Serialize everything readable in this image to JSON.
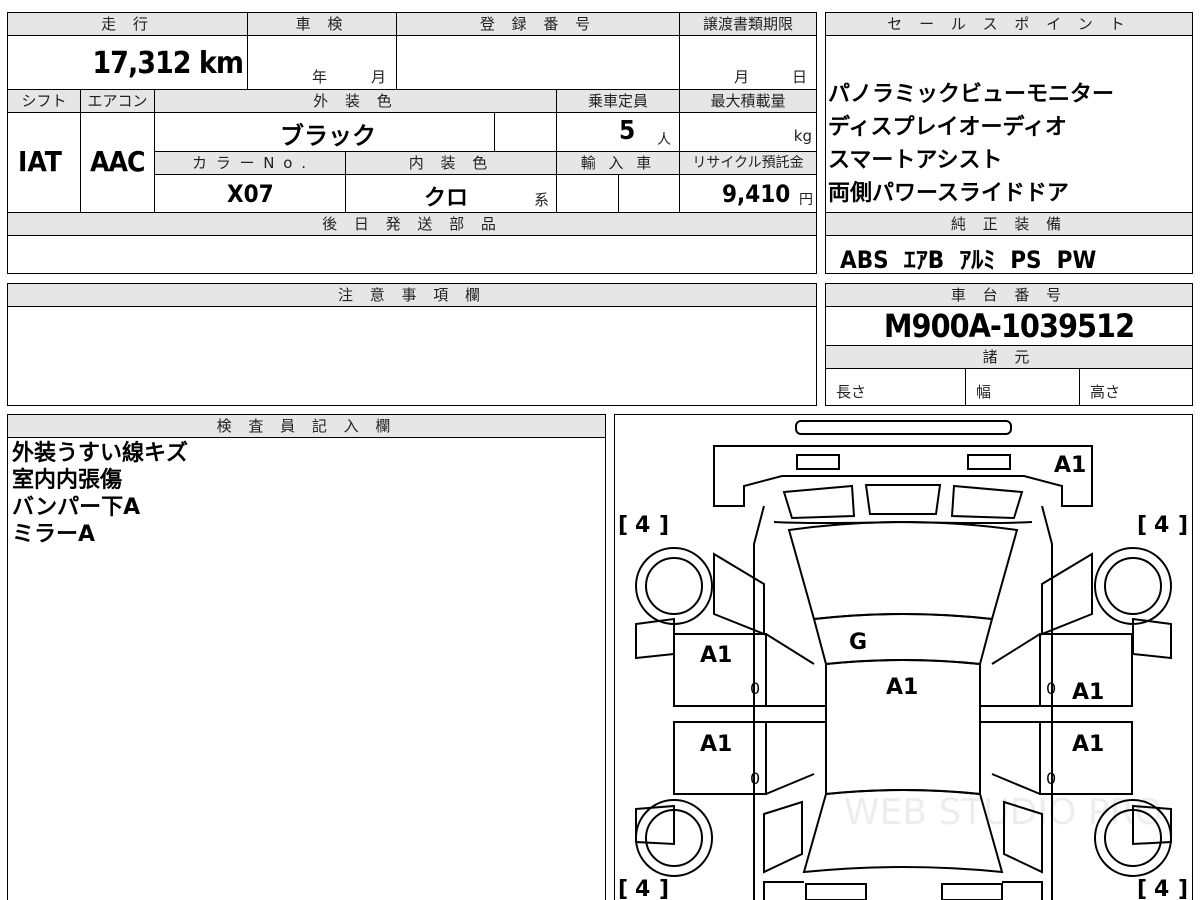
{
  "top_table": {
    "mileage_label": "走 行",
    "mileage_value": "17,312 km",
    "inspection_label": "車 検",
    "inspection_year_unit": "年",
    "inspection_month_unit": "月",
    "registration_label": "登 録 番 号",
    "transfer_deadline_label": "譲渡書類期限",
    "transfer_month_unit": "月",
    "transfer_day_unit": "日",
    "shift_label": "シフト",
    "shift_value": "IAT",
    "aircon_label": "エアコン",
    "aircon_value": "AAC",
    "exterior_color_label": "外 装 色",
    "exterior_color_value": "ブラック",
    "capacity_label": "乗車定員",
    "capacity_value": "5",
    "capacity_unit": "人",
    "max_load_label": "最大積載量",
    "max_load_unit": "kg",
    "color_no_label": "カ ラ ー N o .",
    "color_no_value": "X07",
    "interior_color_label": "内 装 色",
    "interior_color_value": "クロ",
    "interior_color_suffix": "系",
    "import_label": "輸 入 車",
    "recycle_label": "リサイクル預託金",
    "recycle_value": "9,410",
    "recycle_unit": "円",
    "parts_label": "後 日 発 送 部 品"
  },
  "sales_points": {
    "label": "セ ー ル ス ポ イ ン ト",
    "items": [
      "パノラミックビューモニター",
      "ディスプレイオーディオ",
      "スマートアシスト",
      "両側パワースライドドア"
    ]
  },
  "standard_equipment": {
    "label": "純 正 装 備",
    "value": "ABS  ｴｱB  ｱﾙﾐ  PS  PW"
  },
  "notes": {
    "label": "注 意 事 項 欄"
  },
  "chassis": {
    "label": "車 台 番 号",
    "value": "M900A-1039512",
    "specs_label": "諸 元",
    "length_label": "長さ",
    "width_label": "幅",
    "height_label": "高さ"
  },
  "inspector": {
    "label": "検 査 員 記 入 欄",
    "lines": [
      "外装うすい線キズ",
      "室内内張傷",
      "バンパー下A",
      "ミラーA"
    ]
  },
  "diagram": {
    "tire_front_left": "4",
    "tire_front_right": "4",
    "tire_rear_left": "4",
    "tire_rear_right": "4",
    "front_bumper": "A1",
    "hood": "G",
    "roof": "A1",
    "front_left_door": "A1",
    "rear_left_door": "A1",
    "front_right_door": "A1",
    "rear_right_door": "A1",
    "door_small_marks": [
      "0",
      "0",
      "0",
      "0"
    ],
    "watermark": "WEB STUDIO PRO"
  }
}
